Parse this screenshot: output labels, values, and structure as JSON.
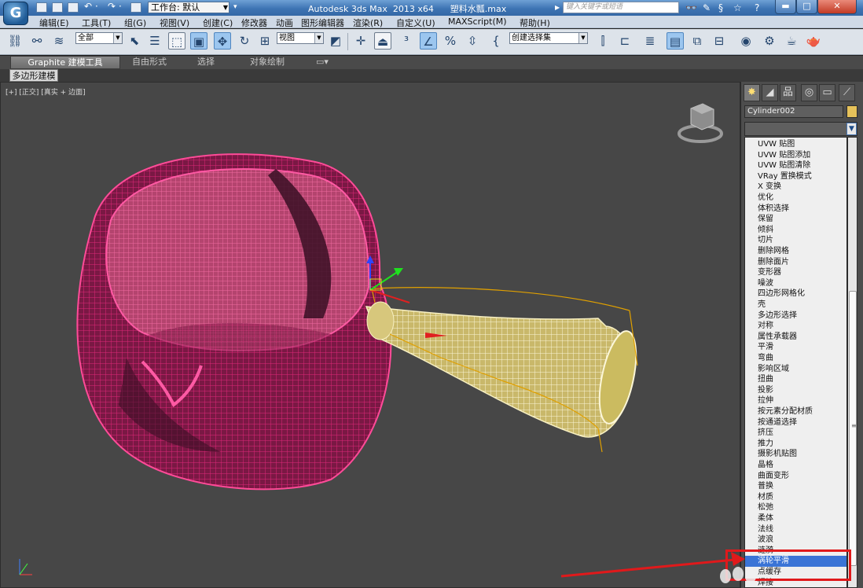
{
  "titlebar": {
    "workspace": "工作台: 默认",
    "title": "Autodesk 3ds Max  2013 x64      塑料水瓢.max",
    "search_placeholder": "键入关键字或短语"
  },
  "menu": [
    "编辑(E)",
    "工具(T)",
    "组(G)",
    "视图(V)",
    "创建(C)",
    "修改器",
    "动画",
    "图形编辑器",
    "渲染(R)",
    "自定义(U)",
    "MAXScript(M)",
    "帮助(H)"
  ],
  "toolbar": {
    "selection_filter": "全部",
    "reference_coord": "视图",
    "named_selection": "创建选择集"
  },
  "ribbon": {
    "tabs": [
      "Graphite 建模工具",
      "自由形式",
      "选择",
      "对象绘制"
    ],
    "subtab": "多边形建模"
  },
  "viewport": {
    "label": "[+] [正交] [真实 + 边面]"
  },
  "command_panel": {
    "object_name": "Cylinder002",
    "modifiers": [
      "UVW 贴图",
      "UVW 贴图添加",
      "UVW 贴图清除",
      "VRay 置换模式",
      "X 变换",
      "优化",
      "体积选择",
      "保留",
      "倾斜",
      "切片",
      "删除网格",
      "删除面片",
      "变形器",
      "噪波",
      "四边形网格化",
      "壳",
      "多边形选择",
      "对称",
      "属性承载器",
      "平滑",
      "弯曲",
      "影响区域",
      "扭曲",
      "投影",
      "拉伸",
      "按元素分配材质",
      "按通道选择",
      "挤压",
      "推力",
      "摄影机贴图",
      "晶格",
      "曲面变形",
      "普换",
      "材质",
      "松弛",
      "柔体",
      "法线",
      "波浪",
      "涟漪",
      "涡轮平滑",
      "点缓存",
      "焊接"
    ],
    "selected_modifier": "涡轮平滑"
  },
  "colors": {
    "pot_wire": "#e0287a",
    "handle_wire": "#f2e8a6",
    "selection_box": "#e0a000",
    "annotation": "#e0191b"
  }
}
